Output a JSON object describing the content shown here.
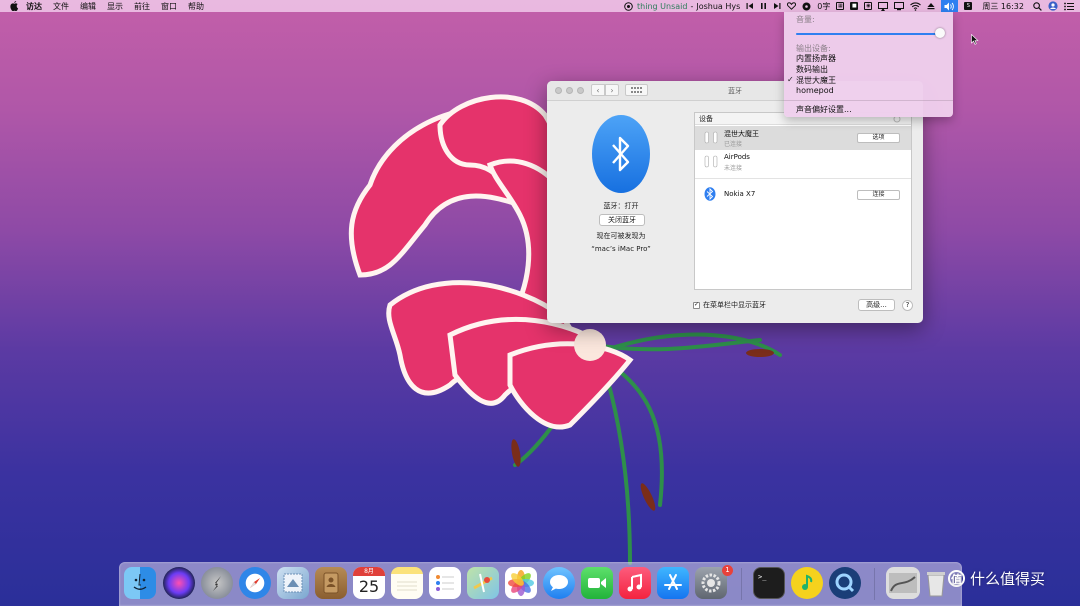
{
  "menubar": {
    "app_menu": "访达",
    "items": [
      "文件",
      "编辑",
      "显示",
      "前往",
      "窗口",
      "帮助"
    ],
    "now_playing": {
      "title": "thing Unsaid",
      "separator": "-",
      "artist": "Joshua Hys"
    },
    "status_text": "0字",
    "clock": "周三 16:32"
  },
  "volume_menu": {
    "volume_label": "音量:",
    "volume_level": 0.99,
    "output_label": "输出设备:",
    "options": [
      "内置扬声器",
      "数码输出",
      "混世大魔王",
      "homepod"
    ],
    "checkmark": "✓",
    "selected_option": "混世大魔王",
    "preferences": "声音偏好设置..."
  },
  "bluetooth_window": {
    "title": "蓝牙",
    "status": "蓝牙：打开",
    "toggle_button": "关闭蓝牙",
    "discoverable_as": "现在可被发现为",
    "device_name": "“mac’s iMac Pro”",
    "devices_header": "设备",
    "devices": [
      {
        "name": "混世大魔王",
        "status": "已连接",
        "button": "选项",
        "selected": true
      },
      {
        "name": "AirPods",
        "status": "未连接",
        "button": "",
        "selected": false
      },
      {
        "name": "Nokia X7",
        "status": "",
        "button": "连接",
        "selected": false
      }
    ],
    "checkbox_checked": true,
    "checkbox_mark": "✓",
    "show_in_menubar": "在菜单栏中显示蓝牙",
    "advanced_button": "高级...",
    "help_button": "?"
  },
  "dock": {
    "calendar_month": "8月",
    "calendar_day": "25",
    "app_store_badge": "1",
    "terminal_prompt": ">_"
  },
  "watermark": {
    "symbol": "值",
    "text": "什么值得买"
  },
  "colors": {
    "accent_blue": "#2f7ff0",
    "menubar_bg": "#ecc0e4",
    "song_green": "#2e7d5b",
    "badge_red": "#e8413a"
  }
}
